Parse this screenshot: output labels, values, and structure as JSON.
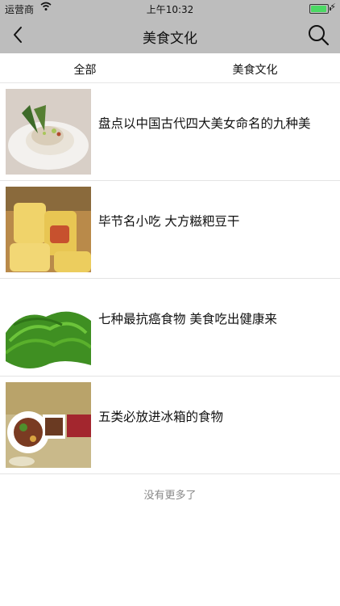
{
  "status_bar": {
    "carrier": "运营商",
    "time": "上午10:32"
  },
  "nav": {
    "title": "美食文化"
  },
  "tabs": [
    {
      "label": "全部"
    },
    {
      "label": "美食文化"
    }
  ],
  "articles": [
    {
      "title": "盘点以中国古代四大美女命名的九种美"
    },
    {
      "title": "毕节名小吃 大方糍粑豆干"
    },
    {
      "title": "七种最抗癌食物 美食吃出健康来"
    },
    {
      "title": "五类必放进冰箱的食物"
    }
  ],
  "footer": {
    "text": "没有更多了"
  },
  "colors": {
    "bar_bg": "#bdbdbd",
    "battery": "#4cd964"
  }
}
